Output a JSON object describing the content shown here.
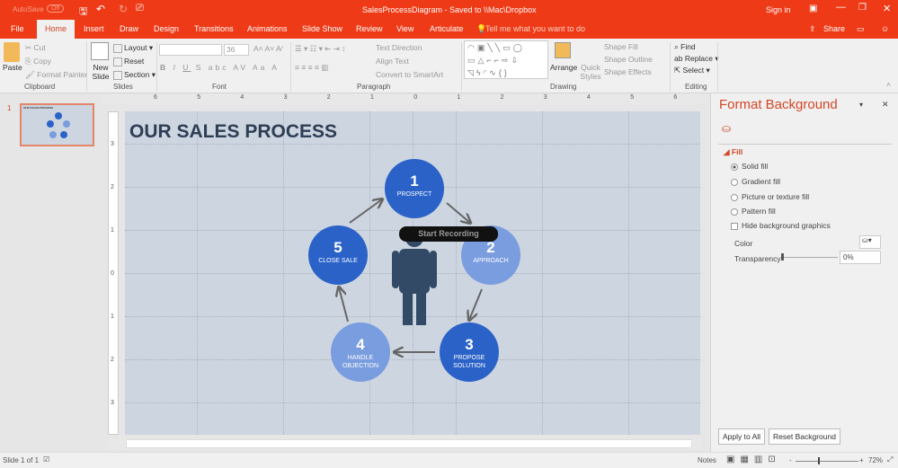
{
  "titlebar": {
    "autosave": "AutoSave",
    "autosave_state": "Off",
    "doc_title": "SalesProcessDiagram  -  Saved to \\\\Mac\\Dropbox",
    "sign_in": "Sign in"
  },
  "tabs": [
    {
      "label": "File"
    },
    {
      "label": "Home"
    },
    {
      "label": "Insert"
    },
    {
      "label": "Draw"
    },
    {
      "label": "Design"
    },
    {
      "label": "Transitions"
    },
    {
      "label": "Animations"
    },
    {
      "label": "Slide Show"
    },
    {
      "label": "Review"
    },
    {
      "label": "View"
    },
    {
      "label": "Articulate"
    }
  ],
  "tell_me": "Tell me what you want to do",
  "share": "Share",
  "ribbon": {
    "clipboard": {
      "label": "Clipboard",
      "paste": "Paste",
      "cut": "Cut",
      "copy": "Copy",
      "format_painter": "Format Painter"
    },
    "slides": {
      "label": "Slides",
      "new_slide": "New Slide",
      "layout": "Layout",
      "reset": "Reset",
      "section": "Section"
    },
    "font": {
      "label": "Font",
      "font_name": "",
      "font_size": "36"
    },
    "paragraph": {
      "label": "Paragraph",
      "text_direction": "Text Direction",
      "align_text": "Align Text",
      "convert": "Convert to SmartArt"
    },
    "drawing": {
      "label": "Drawing",
      "arrange": "Arrange",
      "quick_styles": "Quick Styles",
      "shape_fill": "Shape Fill",
      "shape_outline": "Shape Outline",
      "shape_effects": "Shape Effects"
    },
    "editing": {
      "label": "Editing",
      "find": "Find",
      "replace": "Replace",
      "select": "Select"
    }
  },
  "ruler_h": [
    "6",
    "5",
    "4",
    "3",
    "2",
    "1",
    "0",
    "1",
    "2",
    "3",
    "4",
    "5",
    "6"
  ],
  "ruler_v": [
    "3",
    "2",
    "1",
    "0",
    "1",
    "2",
    "3"
  ],
  "thumbnail": {
    "number": "1",
    "title": "OUR SALES PROCESS"
  },
  "slide": {
    "title": "OUR SALES PROCESS",
    "steps": [
      {
        "num": "1",
        "label": "PROSPECT",
        "color": "#2a62c8"
      },
      {
        "num": "2",
        "label": "APPROACH",
        "color": "#7a9ddf"
      },
      {
        "num": "3",
        "label": "PROPOSE SOLUTION",
        "color": "#2a62c8"
      },
      {
        "num": "4",
        "label": "HANDLE OBJECTION",
        "color": "#7a9ddf"
      },
      {
        "num": "5",
        "label": "CLOSE SALE",
        "color": "#2a62c8"
      }
    ],
    "recording": "Start Recording"
  },
  "format_bg": {
    "title": "Format Background",
    "section": "Fill",
    "options": [
      "Solid fill",
      "Gradient fill",
      "Picture or texture fill",
      "Pattern fill"
    ],
    "selected": "Solid fill",
    "hide_bg": "Hide background graphics",
    "color_label": "Color",
    "transparency_label": "Transparency",
    "transparency": "0%",
    "apply_all": "Apply to All",
    "reset": "Reset Background"
  },
  "status": {
    "slide": "Slide 1 of 1",
    "notes": "Notes",
    "zoom": "72%"
  },
  "colors": {
    "accent": "#ee3a16",
    "slide_bg": "#cdd5e0"
  }
}
